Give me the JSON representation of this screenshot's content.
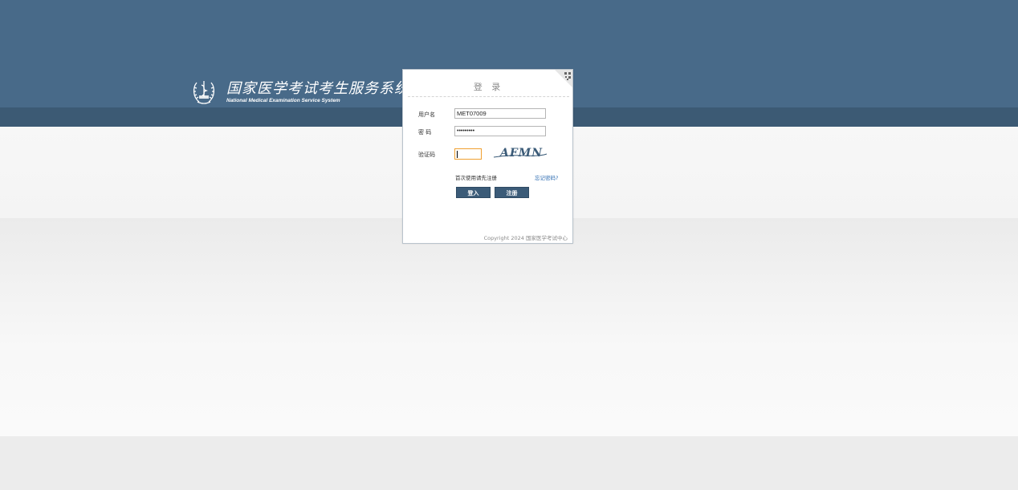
{
  "brand": {
    "title_cn": "国家医学考试考生服务系统",
    "title_en": "National Medical Examination Service System",
    "emblem_icon": "medical-caduceus-wreath-icon"
  },
  "login": {
    "title": "登 录",
    "corner_icon": "qr-code-icon",
    "username_label": "用户名",
    "username_value": "MET07009",
    "password_label": "密 码",
    "password_value": "•••••••••",
    "captcha_label": "验证码",
    "captcha_value": "",
    "captcha_text": "AFMN",
    "hint_text": "首次使用请先注册",
    "forgot_link": "忘记密码?",
    "login_button": "登入",
    "register_button": "注册",
    "copyright": "Copyright 2024 国家医学考试中心"
  },
  "colors": {
    "header_bg": "#486a89",
    "header_strip": "#3c5a74",
    "button_bg": "#3b5b78",
    "link": "#2a6ab0",
    "captcha_focus": "#f0a030"
  }
}
